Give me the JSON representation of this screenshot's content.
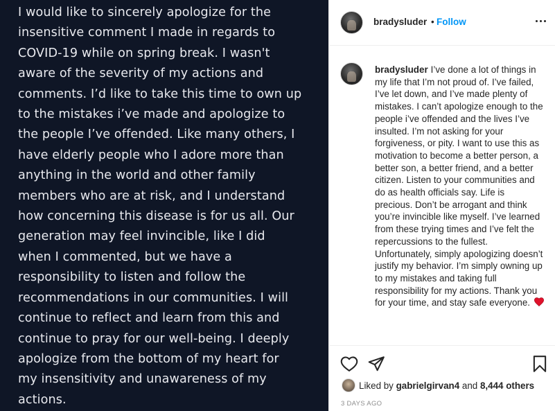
{
  "post_image": {
    "text": "I would like to sincerely apologize for the\ninsensitive comment I made in regards to\nCOVID-19 while on spring break. I wasn't\naware of the severity of my actions and\ncomments. I’d like to take this time to own up\nto the mistakes i’ve made and apologize to\nthe people I’ve offended. Like many others, I\nhave elderly people who I adore more than\nanything in the world and other family\nmembers who are at risk, and I understand\nhow concerning this disease is for us all. Our\ngeneration may feel invincible, like I did\nwhen I commented, but we have a\nresponsibility to listen and follow the\nrecommendations in our communities. I will\ncontinue to reflect and learn from this and\ncontinue to pray for our well-being. I deeply\napologize from the bottom of my heart for\nmy insensitivity and unawareness of my\nactions.",
    "background": "#0f1626"
  },
  "header": {
    "username": "bradysluder",
    "separator": "•",
    "follow_label": "Follow",
    "follow_color": "#0095f6"
  },
  "caption": {
    "username": "bradysluder",
    "text": "I’ve done a lot of things in my life that I’m not proud of. I’ve failed, I’ve let down, and I’ve made plenty of mistakes. I can’t apologize enough to the people i’ve offended and the lives I’ve insulted. I’m not asking for your forgiveness, or pity. I want to use this as motivation to become a better person, a better son, a better friend, and a better citizen. Listen to your communities and do as health officials say. Life is precious. Don’t be arrogant and think you’re invincible like myself. I’ve learned from these trying times and I’ve felt the repercussions to the fullest. Unfortunately, simply apologizing doesn’t justify my behavior. I’m simply owning up to my mistakes and taking full responsibility for my actions. Thank you for your time, and stay safe everyone.",
    "emoji": "red-heart-emoji"
  },
  "actions": {
    "icons": [
      "heart-outline-icon",
      "paper-plane-icon",
      "bookmark-icon"
    ]
  },
  "likes": {
    "prefix": "Liked by",
    "user": "gabrielgirvan4",
    "conjunction": "and",
    "others": "8,444 others"
  },
  "timestamp": "3 DAYS AGO"
}
